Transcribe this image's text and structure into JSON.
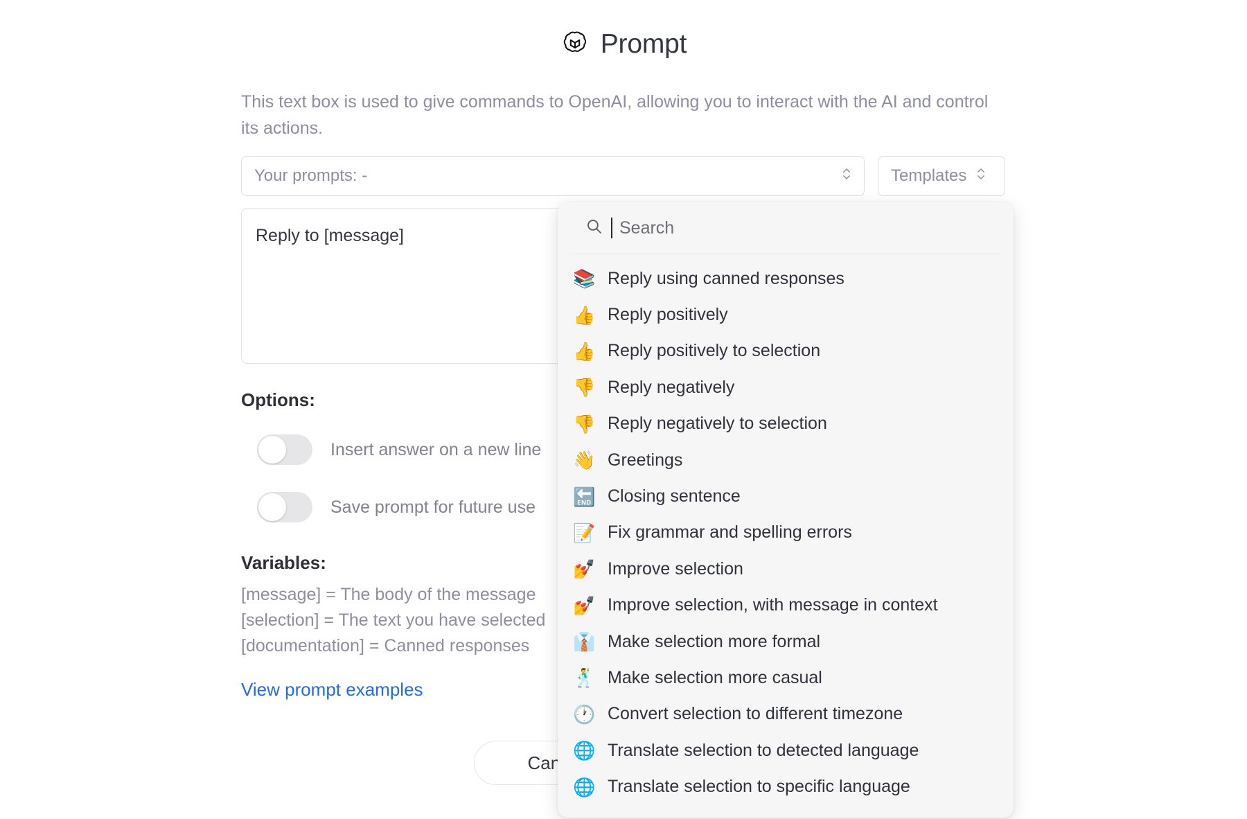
{
  "header": {
    "title": "Prompt",
    "logo_icon": "openai-logo-icon"
  },
  "description": "This text box is used to give commands to OpenAI, allowing you to interact with the AI and control its actions.",
  "selects": {
    "prompts": {
      "label": "Your prompts: -",
      "icon": "chevron-up-down-icon"
    },
    "templates": {
      "label": "Templates",
      "icon": "chevron-up-down-icon"
    }
  },
  "prompt_textarea": {
    "value": "Reply to [message]",
    "placeholder": ""
  },
  "options": {
    "title": "Options:",
    "toggles": [
      {
        "label": "Insert answer on a new line",
        "state": "off"
      },
      {
        "label": "Save prompt for future use",
        "state": "off"
      }
    ]
  },
  "variables": {
    "title": "Variables:",
    "lines": [
      "[message] = The body of the message",
      "[selection] = The text you have selected",
      "[documentation] = Canned responses"
    ]
  },
  "links": {
    "view_examples": "View prompt examples"
  },
  "buttons": {
    "cancel": "Cancel"
  },
  "dropdown": {
    "search": {
      "placeholder": "Search",
      "value": "",
      "icon": "search-icon"
    },
    "items": [
      {
        "emoji": "📚",
        "icon_name": "books-icon",
        "label": "Reply using canned responses"
      },
      {
        "emoji": "👍",
        "icon_name": "thumbs-up-icon",
        "label": "Reply positively"
      },
      {
        "emoji": "👍",
        "icon_name": "thumbs-up-icon",
        "label": "Reply positively to selection"
      },
      {
        "emoji": "👎",
        "icon_name": "thumbs-down-icon",
        "label": "Reply negatively"
      },
      {
        "emoji": "👎",
        "icon_name": "thumbs-down-icon",
        "label": "Reply negatively to selection"
      },
      {
        "emoji": "👋",
        "icon_name": "waving-hand-icon",
        "label": "Greetings"
      },
      {
        "emoji": "🔚",
        "icon_name": "end-arrow-icon",
        "label": "Closing sentence"
      },
      {
        "emoji": "📝",
        "icon_name": "memo-icon",
        "label": "Fix grammar and spelling errors"
      },
      {
        "emoji": "💅",
        "icon_name": "nail-polish-icon",
        "label": "Improve selection"
      },
      {
        "emoji": "💅",
        "icon_name": "nail-polish-icon",
        "label": "Improve selection, with message in context"
      },
      {
        "emoji": "👔",
        "icon_name": "necktie-icon",
        "label": "Make selection more formal"
      },
      {
        "emoji": "🕺",
        "icon_name": "man-dancing-icon",
        "label": "Make selection more casual"
      },
      {
        "emoji": "🕐",
        "icon_name": "clock-icon",
        "label": "Convert selection to different timezone"
      },
      {
        "emoji": "🌐",
        "icon_name": "globe-icon",
        "label": "Translate selection to detected language"
      },
      {
        "emoji": "🌐",
        "icon_name": "globe-icon",
        "label": "Translate selection to specific language"
      }
    ]
  },
  "colors": {
    "link": "#246bea",
    "text": "#353740",
    "muted": "#8e8ea0",
    "dropdown_bg": "#f6f6f7",
    "page_bg": "#ffffff"
  }
}
